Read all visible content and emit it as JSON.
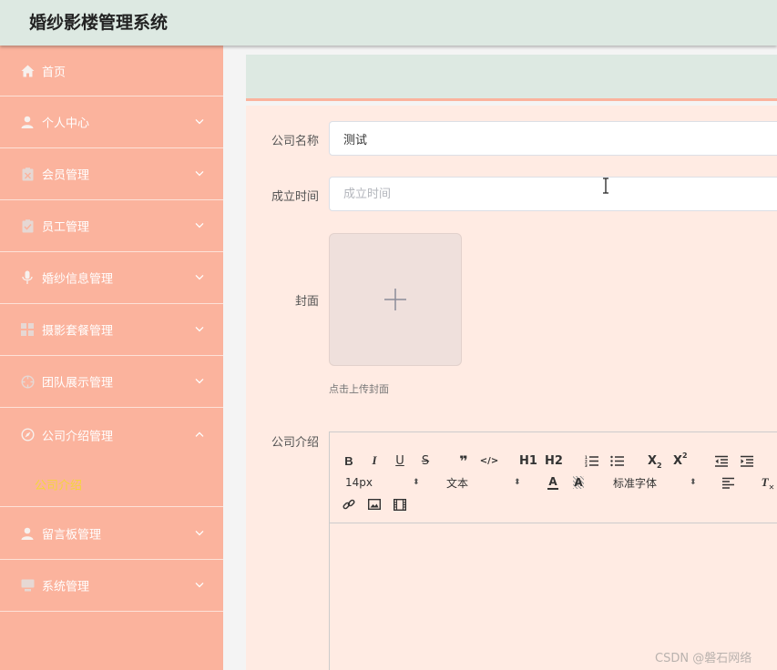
{
  "app": {
    "title": "婚纱影楼管理系统"
  },
  "sidebar": {
    "items": [
      {
        "label": "首页",
        "icon": "home-icon"
      },
      {
        "label": "个人中心",
        "icon": "user-icon"
      },
      {
        "label": "会员管理",
        "icon": "clipboard-icon"
      },
      {
        "label": "员工管理",
        "icon": "clipboard-check-icon"
      },
      {
        "label": "婚纱信息管理",
        "icon": "microphone-icon"
      },
      {
        "label": "摄影套餐管理",
        "icon": "grid-icon"
      },
      {
        "label": "团队展示管理",
        "icon": "crosshair-icon"
      },
      {
        "label": "公司介绍管理",
        "icon": "compass-icon"
      },
      {
        "label": "留言板管理",
        "icon": "user-icon"
      },
      {
        "label": "系统管理",
        "icon": "monitor-icon"
      }
    ],
    "active_sub": {
      "label": "公司介绍"
    }
  },
  "form": {
    "company_name": {
      "label": "公司名称",
      "value": "测试"
    },
    "founded": {
      "label": "成立时间",
      "placeholder": "成立时间"
    },
    "cover": {
      "label": "封面",
      "tip": "点击上传封面"
    },
    "intro": {
      "label": "公司介绍"
    }
  },
  "editor": {
    "font_size": "14px",
    "block_type": "文本",
    "font_family": "标准字体",
    "btn_h1": "H1",
    "btn_h2": "H2",
    "btn_sub": "X",
    "btn_sup": "X"
  },
  "watermark": "CSDN @磐石网络",
  "colors": {
    "header_bg": "#dde9e2",
    "sidebar_bg": "#fbb39d",
    "active_sub_text": "#f5d53a",
    "form_bg": "#ffebe3"
  }
}
